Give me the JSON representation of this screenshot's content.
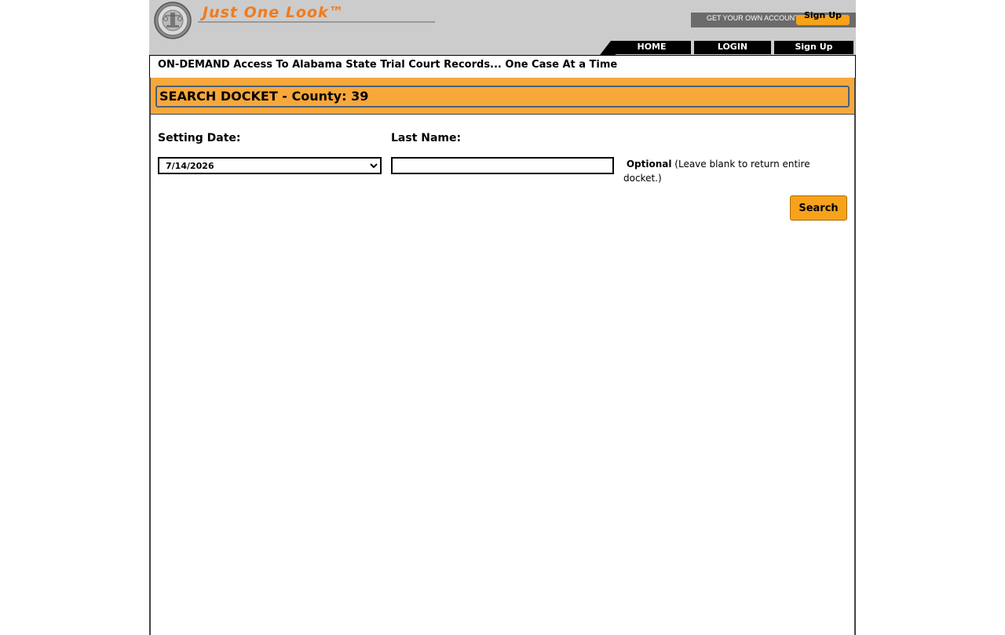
{
  "header": {
    "brand": "Just One Look™",
    "account_text": "GET YOUR OWN ACCOUNT",
    "account_signup_label": "Sign Up",
    "nav": {
      "home": "HOME",
      "login": "LOGIN",
      "signup": "Sign Up"
    }
  },
  "tagline": "ON-DEMAND Access To Alabama State Trial Court Records... One Case At a Time",
  "panel": {
    "title": "SEARCH DOCKET - County: 39",
    "setting_date_label": "Setting Date:",
    "setting_date_value": "7/14/2026",
    "last_name_label": "Last Name:",
    "last_name_value": "",
    "hint_bold": "Optional",
    "hint_text": " (Leave blank to return entire docket.)",
    "search_label": "Search"
  },
  "colors": {
    "brand_orange": "#f07b1c",
    "panel_orange": "#f7a83b",
    "button_orange": "#f7a21b",
    "header_gray": "#cccccc"
  },
  "icons": {
    "seal": "court-seal-icon",
    "select_arrow": "chevron-down-icon"
  }
}
